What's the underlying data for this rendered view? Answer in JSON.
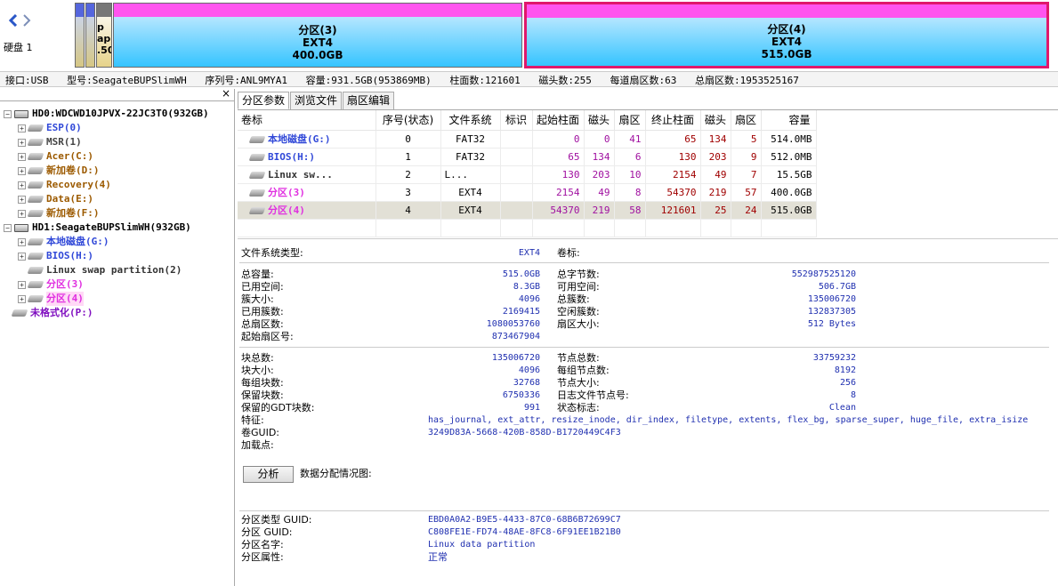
{
  "disk_label": "硬盘 1",
  "bars": {
    "small3": "p\nap\n.50",
    "p3": {
      "name": "分区(3)",
      "fs": "EXT4",
      "size": "400.0GB"
    },
    "p4": {
      "name": "分区(4)",
      "fs": "EXT4",
      "size": "515.0GB"
    }
  },
  "infoline": {
    "interface": "接口:USB",
    "model": "型号:SeagateBUPSlimWH",
    "serial": "序列号:ANL9MYA1",
    "capacity": "容量:931.5GB(953869MB)",
    "cylinders": "柱面数:121601",
    "heads": "磁头数:255",
    "sectors_per_track": "每道扇区数:63",
    "total_sectors": "总扇区数:1953525167"
  },
  "left_close": "×",
  "tree": {
    "hd0": "HD0:WDCWD10JPVX-22JC3T0(932GB)",
    "hd0_items": [
      "ESP(0)",
      "MSR(1)",
      "Acer(C:)",
      "新加卷(D:)",
      "Recovery(4)",
      "Data(E:)",
      "新加卷(F:)"
    ],
    "hd1": "HD1:SeagateBUPSlimWH(932GB)",
    "hd1_items": [
      "本地磁盘(G:)",
      "BIOS(H:)",
      "Linux swap partition(2)",
      "分区(3)",
      "分区(4)"
    ],
    "unformatted": "未格式化(P:)"
  },
  "tabs": [
    "分区参数",
    "浏览文件",
    "扇区编辑"
  ],
  "columns": [
    "卷标",
    "序号(状态)",
    "文件系统",
    "标识",
    "起始柱面",
    "磁头",
    "扇区",
    "终止柱面",
    "磁头",
    "扇区",
    "容量"
  ],
  "rows": [
    [
      "本地磁盘(G:)",
      "0",
      "FAT32",
      "",
      "0",
      "0",
      "41",
      "65",
      "134",
      "5",
      "514.0MB"
    ],
    [
      "BIOS(H:)",
      "1",
      "FAT32",
      "",
      "65",
      "134",
      "6",
      "130",
      "203",
      "9",
      "512.0MB"
    ],
    [
      "Linux sw...",
      "2",
      "L...",
      "",
      "130",
      "203",
      "10",
      "2154",
      "49",
      "7",
      "15.5GB"
    ],
    [
      "分区(3)",
      "3",
      "EXT4",
      "",
      "2154",
      "49",
      "8",
      "54370",
      "219",
      "57",
      "400.0GB"
    ],
    [
      "分区(4)",
      "4",
      "EXT4",
      "",
      "54370",
      "219",
      "58",
      "121601",
      "25",
      "24",
      "515.0GB"
    ]
  ],
  "details": {
    "fs_type_label": "文件系统类型:",
    "fs_type": "EXT4",
    "vol_label_label": "卷标:",
    "left1": [
      [
        "总容量:",
        "515.0GB"
      ],
      [
        "已用空间:",
        "8.3GB"
      ],
      [
        "簇大小:",
        "4096"
      ],
      [
        "已用簇数:",
        "2169415"
      ],
      [
        "总扇区数:",
        "1080053760"
      ],
      [
        "起始扇区号:",
        "873467904"
      ]
    ],
    "right1": [
      [
        "总字节数:",
        "552987525120"
      ],
      [
        "可用空间:",
        "506.7GB"
      ],
      [
        "总簇数:",
        "135006720"
      ],
      [
        "空闲簇数:",
        "132837305"
      ],
      [
        "扇区大小:",
        "512 Bytes"
      ]
    ],
    "left2": [
      [
        "块总数:",
        "135006720"
      ],
      [
        "块大小:",
        "4096"
      ],
      [
        "每组块数:",
        "32768"
      ],
      [
        "保留块数:",
        "6750336"
      ],
      [
        "保留的GDT块数:",
        "991"
      ]
    ],
    "right2": [
      [
        "节点总数:",
        "33759232"
      ],
      [
        "每组节点数:",
        "8192"
      ],
      [
        "节点大小:",
        "256"
      ],
      [
        "日志文件节点号:",
        "8"
      ],
      [
        "状态标志:",
        "Clean"
      ]
    ],
    "features_label": "特征:",
    "features": "has_journal, ext_attr, resize_inode, dir_index, filetype, extents, flex_bg, sparse_super, huge_file, extra_isize",
    "uuid_label": "卷GUID:",
    "uuid": "3249D83A-5668-420B-858D-B1720449C4F3",
    "mount_label": "加载点:",
    "analyze": "分析",
    "chart_label": "数据分配情况图:",
    "bottom": [
      [
        "分区类型 GUID:",
        "EBD0A0A2-B9E5-4433-87C0-68B6B72699C7"
      ],
      [
        "分区 GUID:",
        "C808FE1E-FD74-48AE-8FC8-6F91EE1B21B0"
      ],
      [
        "分区名字:",
        "Linux data partition"
      ],
      [
        "分区属性:",
        "正常"
      ]
    ]
  }
}
